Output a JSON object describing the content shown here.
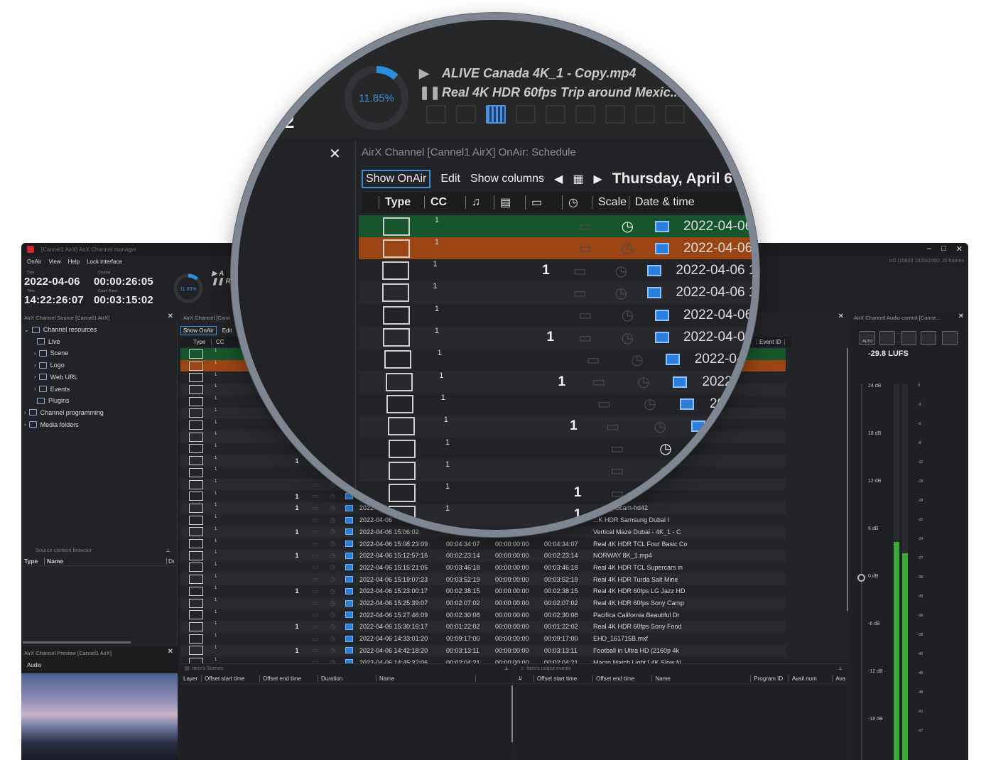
{
  "window": {
    "title": "[Cannel1 AirX] AirX Channel manager",
    "format": "HD (1080i) 1920x1080, 25 frames",
    "controls": [
      "–",
      "□",
      "✕"
    ]
  },
  "menu": [
    "OnAir",
    "View",
    "Help",
    "Lock interface"
  ],
  "clock": {
    "date_label": "Date",
    "date": "2022-04-06",
    "counter_label": "Counter",
    "counter": "00:00:26:05",
    "time_label": "Time",
    "time": "14:22:26:07",
    "countdown_label": "Count Down",
    "countdown": "00:03:15:02"
  },
  "progress": {
    "percent_text": "11.85%",
    "fraction": 0.1185
  },
  "now_playing": {
    "current": "ALIVE  Canada 4K_1 - Copy.mp4",
    "next": "Real 4K HDR 60fps  Trip around Mexic..."
  },
  "lens_time_fragment": ".02",
  "source_panel": {
    "title": "AirX Channel Source [Cannel1 AirX]",
    "tree": [
      {
        "label": "Channel resources",
        "icon": "monitor-icon",
        "indent": 0,
        "chevron": "expanded"
      },
      {
        "label": "Live",
        "icon": "antenna-icon",
        "indent": 1,
        "chevron": ""
      },
      {
        "label": "Scene",
        "icon": "clapper-icon",
        "indent": 1,
        "chevron": "collapsed"
      },
      {
        "label": "Logo",
        "icon": "monitor-icon",
        "indent": 1,
        "chevron": "collapsed"
      },
      {
        "label": "Web URL",
        "icon": "globe-icon",
        "indent": 1,
        "chevron": "collapsed"
      },
      {
        "label": "Events",
        "icon": "bell-icon",
        "indent": 1,
        "chevron": "collapsed"
      },
      {
        "label": "Plugins",
        "icon": "bell-icon",
        "indent": 1,
        "chevron": ""
      },
      {
        "label": "Channel programming",
        "icon": "play-box-icon",
        "indent": 0,
        "chevron": "collapsed"
      },
      {
        "label": "Media folders",
        "icon": "folder-grid-icon",
        "indent": 0,
        "chevron": "collapsed"
      }
    ],
    "content_browser": "Source content browser",
    "cols": [
      "Type",
      "Name",
      "Dı"
    ]
  },
  "preview_panel": {
    "title": "AirX Channel Preview [Cannel1 AirX]",
    "tab": "Audio"
  },
  "schedule": {
    "title": "AirX Channel [Cannel1 AirX] OnAir: Schedule",
    "title_short": "AirX Channel [Cann",
    "tools": [
      "Show OnAir",
      "Edit",
      "Show columns"
    ],
    "date_title": "Thursday, April 6",
    "cols": [
      "Type",
      "CC",
      "Scale",
      "Date & time"
    ],
    "event_col": "Event ID",
    "rows": [
      {
        "state": "onair",
        "cc": "1",
        "bold": "",
        "clock_on": true,
        "dt": "2022-04-06 1",
        "d1": "",
        "d2": "",
        "d3": "",
        "name": ""
      },
      {
        "state": "next",
        "cc": "1",
        "bold": "",
        "clock_on": false,
        "dt": "2022-04-06 1",
        "d1": "",
        "d2": "",
        "d3": "",
        "name": ""
      },
      {
        "state": "",
        "cc": "1",
        "bold": "1",
        "clock_on": false,
        "dt": "2022-04-06 14",
        "d1": "",
        "d2": "",
        "d3": "",
        "name": ""
      },
      {
        "state": "alt",
        "cc": "1",
        "bold": "",
        "clock_on": false,
        "dt": "2022-04-06 14",
        "d1": "",
        "d2": "",
        "d3": "",
        "name": ""
      },
      {
        "state": "",
        "cc": "1",
        "bold": "",
        "clock_on": false,
        "dt": "2022-04-06 1",
        "d1": "",
        "d2": "",
        "d3": "",
        "name": ""
      },
      {
        "state": "alt",
        "cc": "1",
        "bold": "1",
        "clock_on": false,
        "dt": "2022-04-06 1",
        "d1": "",
        "d2": "",
        "d3": "",
        "name": ""
      },
      {
        "state": "",
        "cc": "1",
        "bold": "",
        "clock_on": false,
        "dt": "2022-04-06",
        "d1": "",
        "d2": "",
        "d3": "",
        "name": ""
      },
      {
        "state": "alt",
        "cc": "1",
        "bold": "1",
        "clock_on": false,
        "dt": "2022-04-0",
        "d1": "",
        "d2": "",
        "d3": "",
        "name": ""
      },
      {
        "state": "",
        "cc": "1",
        "bold": "",
        "clock_on": false,
        "dt": "2022-04-",
        "d1": "",
        "d2": "",
        "d3": "",
        "name": ""
      },
      {
        "state": "alt",
        "cc": "1",
        "bold": "1",
        "clock_on": false,
        "dt": "2022-0",
        "d1": "",
        "d2": "",
        "d3": "",
        "name": ""
      },
      {
        "state": "",
        "cc": "1",
        "bold": "",
        "clock_on": true,
        "dt": "202",
        "d1": "",
        "d2": "",
        "d3": "",
        "name": ""
      },
      {
        "state": "alt",
        "cc": "1",
        "bold": "",
        "clock_on": false,
        "dt": "2",
        "d1": "",
        "d2": "",
        "d3": "",
        "name": ""
      },
      {
        "state": "",
        "cc": "1",
        "bold": "1",
        "clock_on": false,
        "dt": "",
        "d1": "",
        "d2": "",
        "d3": "",
        "name": "...eautiful Dr"
      },
      {
        "state": "alt",
        "cc": "1",
        "bold": "1",
        "clock_on": false,
        "dt": "2022",
        "d1": "",
        "d2": "",
        "d3": "",
        "name": "...peg_xdcam-hd42"
      },
      {
        "state": "",
        "cc": "1",
        "bold": "",
        "clock_on": false,
        "dt": "2022-04-06",
        "d1": "",
        "d2": "",
        "d3": "",
        "name": "...K HDR  Samsung Dubai I"
      },
      {
        "state": "alt",
        "cc": "1",
        "bold": "1",
        "clock_on": false,
        "dt": "2022-04-06 15:06:02",
        "d1": "",
        "d2": "",
        "d3": "",
        "name": "Vertical Maze Dubai - 4K_1 - C"
      },
      {
        "state": "",
        "cc": "1",
        "bold": "",
        "clock_on": false,
        "dt": "2022-04-06 15:08:23:09",
        "d1": "00:04:34:07",
        "d2": "00:00:00:00",
        "d3": "00:04:34:07",
        "name": "Real 4K HDR  TCL Four Basic Co"
      },
      {
        "state": "alt",
        "cc": "1",
        "bold": "1",
        "clock_on": false,
        "dt": "2022-04-06 15:12:57:16",
        "d1": "00:02:23:14",
        "d2": "00:00:00:00",
        "d3": "00:02:23:14",
        "name": "NORWAY 8K_1.mp4"
      },
      {
        "state": "",
        "cc": "1",
        "bold": "",
        "clock_on": false,
        "dt": "2022-04-06 15:15:21:05",
        "d1": "00:03:46:18",
        "d2": "00:00:00:00",
        "d3": "00:03:46:18",
        "name": "Real 4K HDR  TCL Supercars in"
      },
      {
        "state": "alt",
        "cc": "1",
        "bold": "",
        "clock_on": false,
        "dt": "2022-04-06 15:19:07:23",
        "d1": "00:03:52:19",
        "d2": "00:00:00:00",
        "d3": "00:03:52:19",
        "name": "Real 4K HDR  Turda Salt Mine"
      },
      {
        "state": "",
        "cc": "1",
        "bold": "1",
        "clock_on": false,
        "dt": "2022-04-06 15:23:00:17",
        "d1": "00:02:38:15",
        "d2": "00:00:00:00",
        "d3": "00:02:38:15",
        "name": "Real 4K HDR 60fps  LG Jazz HD"
      },
      {
        "state": "alt",
        "cc": "1",
        "bold": "",
        "clock_on": false,
        "dt": "2022-04-06 15:25:39:07",
        "d1": "00:02:07:02",
        "d2": "00:00:00:00",
        "d3": "00:02:07:02",
        "name": "Real 4K HDR 60fps  Sony Camp"
      },
      {
        "state": "",
        "cc": "1",
        "bold": "",
        "clock_on": false,
        "dt": "2022-04-06 15:27:46:09",
        "d1": "00:02:30:08",
        "d2": "00:00:00:00",
        "d3": "00:02:30:08",
        "name": "Pacifica California Beautiful Dr"
      },
      {
        "state": "alt",
        "cc": "1",
        "bold": "1",
        "clock_on": false,
        "dt": "2022-04-06 15:30:16:17",
        "d1": "00:01:22:02",
        "d2": "00:00:00:00",
        "d3": "00:01:22:02",
        "name": "Real 4K HDR 60fps  Sony Food"
      },
      {
        "state": "",
        "cc": "1",
        "bold": "",
        "clock_on": false,
        "dt": "2022-04-06 14:33:01:20",
        "d1": "00:09:17:00",
        "d2": "00:00:00:00",
        "d3": "00:09:17:00",
        "name": "EHD_161715B.mxf"
      },
      {
        "state": "alt",
        "cc": "1",
        "bold": "1",
        "clock_on": false,
        "dt": "2022-04-06 14:42:18:20",
        "d1": "00:03:13:11",
        "d2": "00:00:00:00",
        "d3": "00:03:13:11",
        "name": "Football in Ultra HD (2160p 4k"
      },
      {
        "state": "",
        "cc": "1",
        "bold": "",
        "clock_on": false,
        "dt": "2022-04-06 14:45:32:06",
        "d1": "00:02:04:21",
        "d2": "00:00:00:00",
        "d3": "00:02:04:21",
        "name": "Macro Match Light [ 4K Slow N"
      }
    ]
  },
  "scenes_panel": {
    "title": "Item's Scenes",
    "cols": [
      "Layer",
      "Offset start time",
      "Offset end time",
      "Duration",
      "Name"
    ]
  },
  "events_panel": {
    "title": "Item's output events",
    "cols": [
      "#",
      "Offset start time",
      "Offset end time",
      "Name",
      "Program ID",
      "Avail num",
      "Ava"
    ]
  },
  "audio_panel": {
    "title": "AirX Channel Audio control [Canne...",
    "lufs": "-29.8 LUFS",
    "mode_icons": [
      "AUTO",
      "",
      "",
      "",
      ""
    ],
    "db_labels": [
      "24 dB",
      "18 dB",
      "12 dB",
      "6 dB",
      "0 dB",
      "-6 dB",
      "-12 dB",
      "-18 dB"
    ],
    "scale_labels": [
      "0",
      "-3",
      "-6",
      "-9",
      "-12",
      "-15",
      "-18",
      "-21",
      "-24",
      "-27",
      "-30",
      "-33",
      "-36",
      "-39",
      "-42",
      "-45",
      "-48",
      "-51",
      "-57"
    ],
    "level_left": 0.58,
    "level_right": 0.55,
    "accent": "#2b7fdc",
    "meter_green": "#3aa83a"
  },
  "colors": {
    "onair_row": "#17552c",
    "next_row": "#9c4514",
    "progress": "#2b8fe0"
  }
}
